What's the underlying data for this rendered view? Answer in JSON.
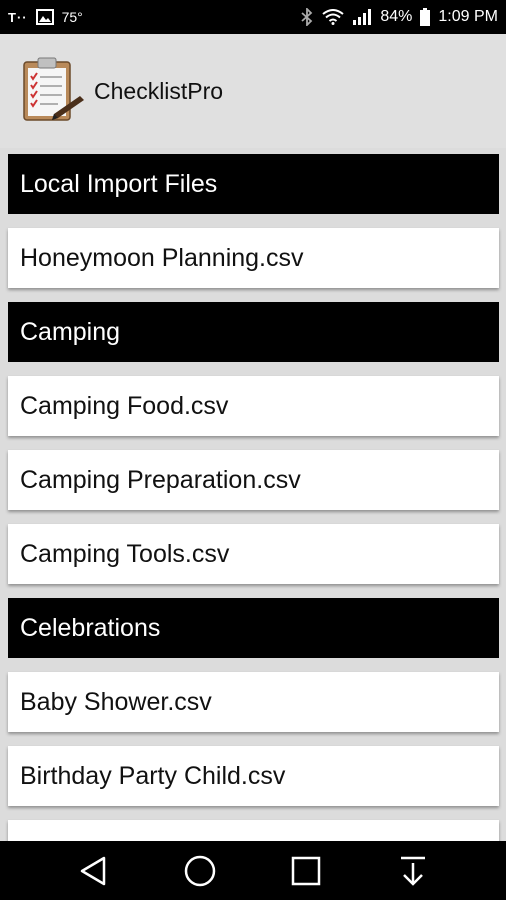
{
  "status_bar": {
    "carrier": "T··",
    "temperature": "75°",
    "battery_percent": "84%",
    "time": "1:09 PM"
  },
  "app_bar": {
    "title": "ChecklistPro",
    "logo_icon": "clipboard-checklist-icon"
  },
  "list": {
    "rows": [
      {
        "type": "header",
        "label": "Local Import Files"
      },
      {
        "type": "item",
        "label": "Honeymoon Planning.csv"
      },
      {
        "type": "header",
        "label": "Camping"
      },
      {
        "type": "item",
        "label": "Camping Food.csv"
      },
      {
        "type": "item",
        "label": "Camping Preparation.csv"
      },
      {
        "type": "item",
        "label": "Camping Tools.csv"
      },
      {
        "type": "header",
        "label": "Celebrations"
      },
      {
        "type": "item",
        "label": "Baby Shower.csv"
      },
      {
        "type": "item",
        "label": "Birthday Party Child.csv"
      },
      {
        "type": "item",
        "label": ""
      }
    ]
  },
  "nav_bar": {
    "buttons": [
      "back-icon",
      "home-icon",
      "recents-icon",
      "download-icon"
    ]
  },
  "colors": {
    "header_bg": "#000000",
    "header_text": "#ffffff",
    "item_bg": "#ffffff",
    "list_bg": "#dcdcdc",
    "app_bar_bg": "#e0e0e0"
  }
}
